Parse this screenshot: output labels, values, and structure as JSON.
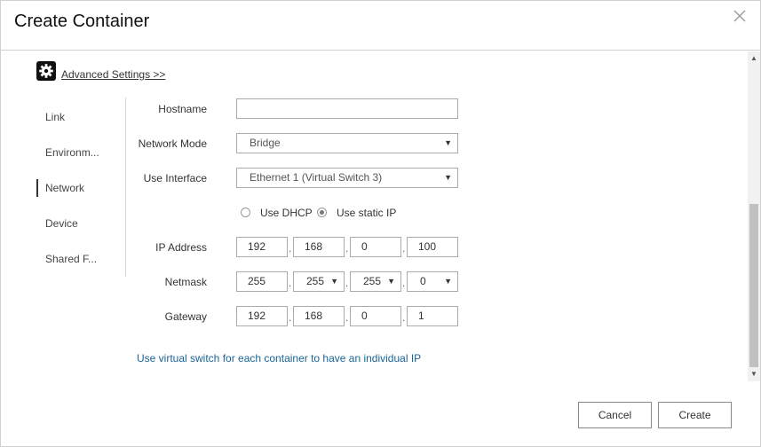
{
  "dialog": {
    "title": "Create Container"
  },
  "advanced": {
    "label": "Advanced Settings >>"
  },
  "sidenav": {
    "items": [
      {
        "label": "Link"
      },
      {
        "label": "Environm..."
      },
      {
        "label": "Network",
        "active": true
      },
      {
        "label": "Device"
      },
      {
        "label": "Shared F..."
      }
    ]
  },
  "network": {
    "hostname_label": "Hostname",
    "hostname_value": "",
    "mode_label": "Network Mode",
    "mode_value": "Bridge",
    "interface_label": "Use Interface",
    "interface_value": "Ethernet 1 (Virtual Switch 3)",
    "dhcp_label": "Use DHCP",
    "static_label": "Use static IP",
    "static_selected": true,
    "ip_label": "IP Address",
    "ip": [
      "192",
      "168",
      "0",
      "100"
    ],
    "netmask_label": "Netmask",
    "netmask": [
      "255",
      "255",
      "255",
      "0"
    ],
    "gateway_label": "Gateway",
    "gateway": [
      "192",
      "168",
      "0",
      "1"
    ],
    "hint": "Use virtual switch for each container to have an individual IP"
  },
  "footer": {
    "cancel_label": "Cancel",
    "create_label": "Create"
  },
  "icons": {
    "close": "close-icon",
    "gear": "gear-icon",
    "dropdown": "chevron-down-icon"
  }
}
